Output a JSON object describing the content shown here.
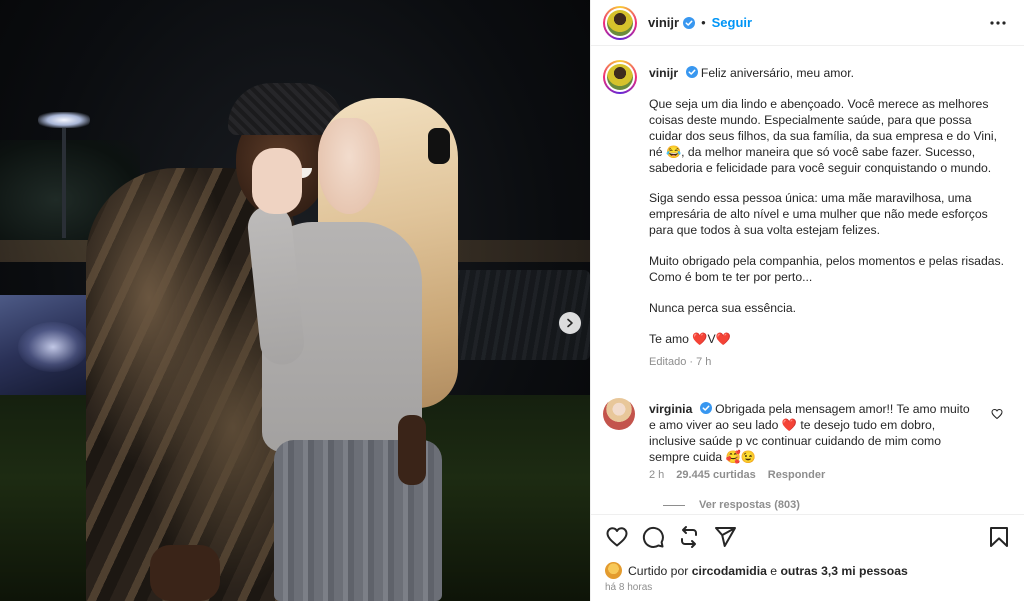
{
  "post": {
    "author": "vinijr",
    "follow_label": "Seguir",
    "separator": "•",
    "caption": {
      "title": "Feliz aniversário, meu amor.",
      "paragraphs": [
        "Que seja um dia lindo e abençoado. Você merece as melhores coisas deste mundo. Especialmente saúde, para que possa cuidar dos seus filhos, da sua família, da sua empresa e do Vini, né 😂, da melhor maneira que só você sabe fazer. Sucesso, sabedoria e felicidade para você seguir conquistando o mundo.",
        "Siga sendo essa pessoa única: uma mãe maravilhosa, uma empresária de alto nível e uma mulher que não mede esforços para que todos à sua volta estejam felizes.",
        "Muito obrigado pela companhia, pelos momentos e pelas risadas. Como é bom te ter por perto...",
        "Nunca perca sua essência.",
        "Te amo ❤️V❤️"
      ],
      "edited_label": "Editado · 7 h"
    },
    "comment": {
      "author": "virginia",
      "text": "Obrigada pela mensagem amor!! Te amo muito e amo viver ao seu lado ❤️ te desejo tudo em dobro, inclusive saúde p vc continuar cuidando de mim como sempre cuida 🥰😉",
      "time": "2 h",
      "likes": "29.445 curtidas",
      "reply_label": "Responder",
      "view_replies": "Ver respostas (803)"
    },
    "likes_line": {
      "prefix": "Curtido por",
      "user": "circodamidia",
      "middle": "e",
      "others": "outras 3,3 mi pessoas"
    },
    "posted_ago": "há 8 horas"
  },
  "icons": {
    "verified": "verified-badge-icon",
    "more": "more-options-icon",
    "like": "heart-icon",
    "comment": "comment-icon",
    "share_repost": "repost-icon",
    "send": "send-icon",
    "save": "bookmark-icon",
    "next": "chevron-right-icon"
  },
  "colors": {
    "accent": "#0095f6",
    "text": "#262626",
    "secondary": "#8e8e8e",
    "verified": "#3897f0",
    "heart": "#ed4956"
  }
}
